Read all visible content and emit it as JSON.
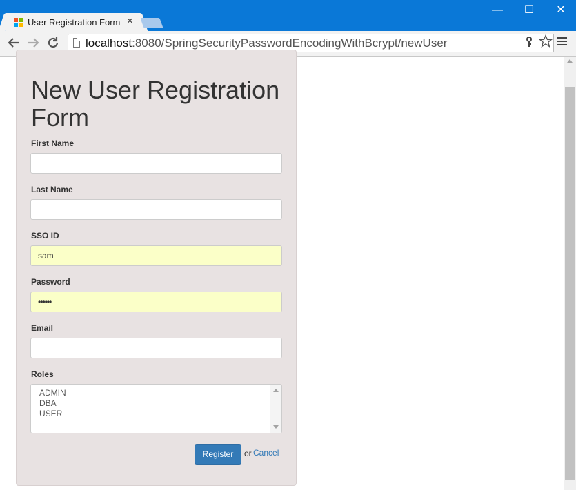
{
  "browser": {
    "tab_title": "User Registration Form",
    "tab_close": "×",
    "window_controls": {
      "minimize": "—",
      "maximize": "☐",
      "close": "✕"
    },
    "url_host": "localhost",
    "url_rest": ":8080/SpringSecurityPasswordEncodingWithBcrypt/newUser",
    "icons": {
      "back": "back-arrow-icon",
      "forward": "forward-arrow-icon",
      "reload": "reload-icon",
      "key": "key-icon",
      "star": "bookmark-star-icon",
      "menu": "hamburger-menu-icon"
    },
    "accent_color": "#0a78d7"
  },
  "form": {
    "heading": "New User Registration Form",
    "fields": {
      "first_name": {
        "label": "First Name",
        "value": ""
      },
      "last_name": {
        "label": "Last Name",
        "value": ""
      },
      "sso_id": {
        "label": "SSO ID",
        "value": "sam"
      },
      "password": {
        "label": "Password",
        "value": "••••••"
      },
      "email": {
        "label": "Email",
        "value": ""
      },
      "roles": {
        "label": "Roles",
        "options": [
          "ADMIN",
          "DBA",
          "USER"
        ]
      }
    },
    "register_label": "Register",
    "or_text": "or",
    "cancel_label": "Cancel",
    "colors": {
      "panel": "#e8e2e2",
      "autofill": "#fbffc8",
      "primary": "#337ab7"
    }
  }
}
